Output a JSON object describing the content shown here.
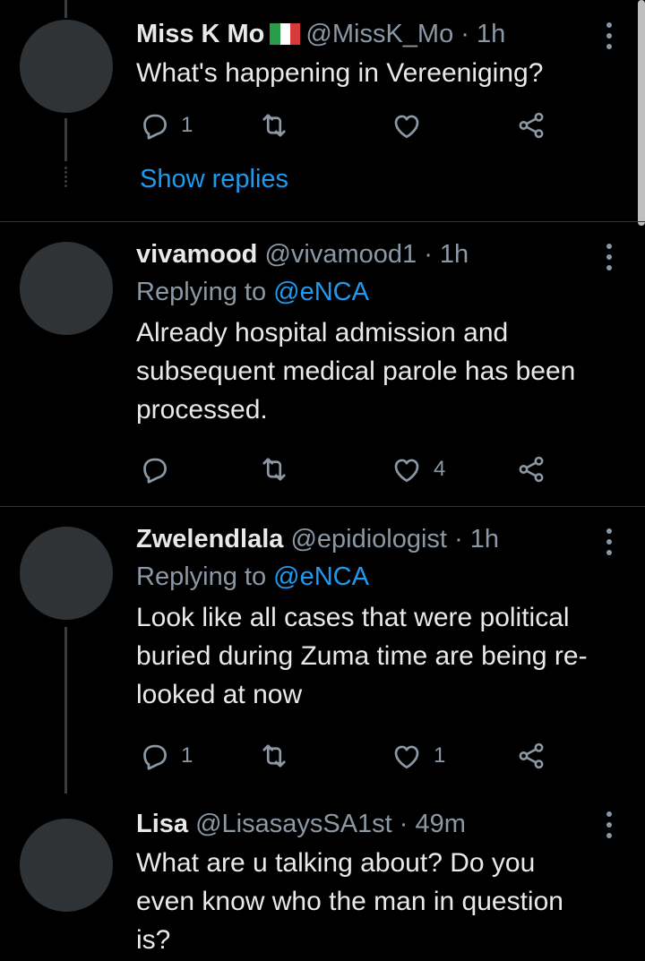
{
  "tweets": [
    {
      "name": "Miss K Mo",
      "flag_icon": "italy-flag-icon",
      "handle": "@MissK_Mo",
      "time": "1h",
      "replying_prefix": "",
      "replying_to": "",
      "text": "What's happening in Vereeniging?",
      "reply_count": "1",
      "retweet_count": "",
      "like_count": "",
      "show_replies": "Show replies"
    },
    {
      "name": "vivamood",
      "handle": "@vivamood1",
      "time": "1h",
      "replying_prefix": "Replying to",
      "replying_to": "@eNCA",
      "text": "Already hospital admission and subsequent medical parole has been processed.",
      "reply_count": "",
      "retweet_count": "",
      "like_count": "4"
    },
    {
      "name": "Zwelendlala",
      "handle": "@epidiologist",
      "time": "1h",
      "replying_prefix": "Replying to",
      "replying_to": "@eNCA",
      "text": "Look like all cases that were political buried during Zuma time are being re-looked at now",
      "reply_count": "1",
      "retweet_count": "",
      "like_count": "1"
    },
    {
      "name": "Lisa",
      "handle": "@LisasaysSA1st",
      "time": "49m",
      "replying_prefix": "",
      "replying_to": "",
      "text": "What are u talking about? Do you even know who the man in question is?"
    }
  ],
  "separator": "·",
  "colors": {
    "background": "#000000",
    "text": "#e7e9ea",
    "muted": "#8b98a5",
    "link": "#1d9bf0",
    "avatar": "#2f3336"
  },
  "icons": [
    "reply-icon",
    "retweet-icon",
    "like-icon",
    "share-icon",
    "more-options-icon"
  ]
}
